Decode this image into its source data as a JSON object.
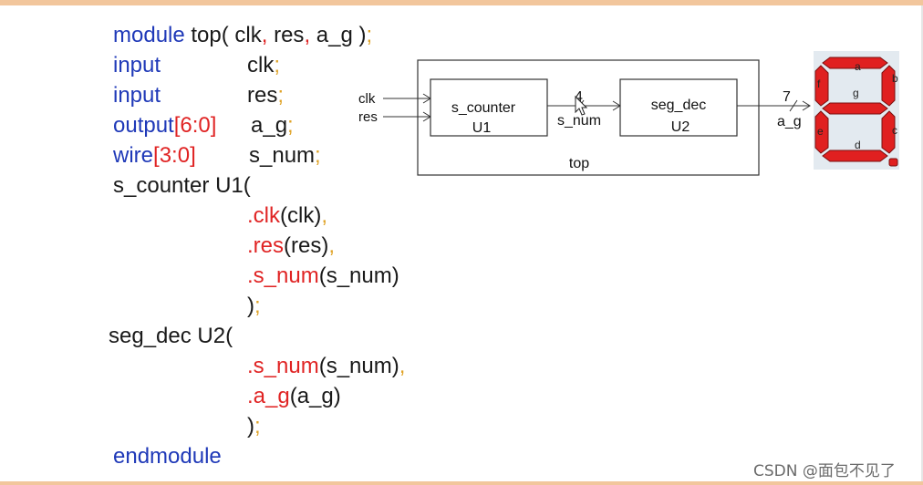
{
  "code": {
    "l1": {
      "kw": "module",
      "a": " top( clk",
      "c1": ",",
      "b": " res",
      "c2": ",",
      "d": " a_g )",
      "semi": ";"
    },
    "l2": {
      "kw": "input",
      "name": "clk",
      "semi": ";"
    },
    "l3": {
      "kw": "input",
      "name": "res",
      "semi": ";"
    },
    "l4": {
      "kw": "output",
      "br_open": "[",
      "num": "6:0",
      "br_close": "]",
      "name": "a_g",
      "semi": ";"
    },
    "l5": {
      "kw": "wire",
      "br_open": "[",
      "num": "3:0",
      "br_close": "]",
      "name": "s_num",
      "semi": ";"
    },
    "l6": {
      "text": "s_counter U1("
    },
    "l7": {
      "port": ".clk",
      "arg": "(clk)",
      "comma": ","
    },
    "l8": {
      "port": ".res",
      "arg": "(res)",
      "comma": ","
    },
    "l9": {
      "port": ".s_num",
      "arg": "(s_num)"
    },
    "l10": {
      "close": ")",
      "semi": ";"
    },
    "l11": {
      "text": "seg_dec U2("
    },
    "l12": {
      "port": ".s_num",
      "arg": "(s_num)",
      "comma": ","
    },
    "l13": {
      "port": ".a_g",
      "arg": "(a_g)"
    },
    "l14": {
      "close": ")",
      "semi": ";"
    },
    "l15": {
      "kw": "endmodule"
    }
  },
  "diagram": {
    "input_clk": "clk",
    "input_res": "res",
    "block1_name": "s_counter",
    "block1_inst": "U1",
    "bus_width_mid": "4",
    "bus_name_mid": "s_num",
    "block2_name": "seg_dec",
    "block2_inst": "U2",
    "top_label": "top",
    "bus_width_out": "7",
    "bus_name_out": "a_g"
  },
  "seven_seg": {
    "seg_a": "a",
    "seg_b": "b",
    "seg_c": "c",
    "seg_d": "d",
    "seg_e": "e",
    "seg_f": "f",
    "seg_g": "g",
    "seg_color": "#e02020",
    "bg_color": "#e3eaf0"
  },
  "watermark": "CSDN @面包不见了"
}
